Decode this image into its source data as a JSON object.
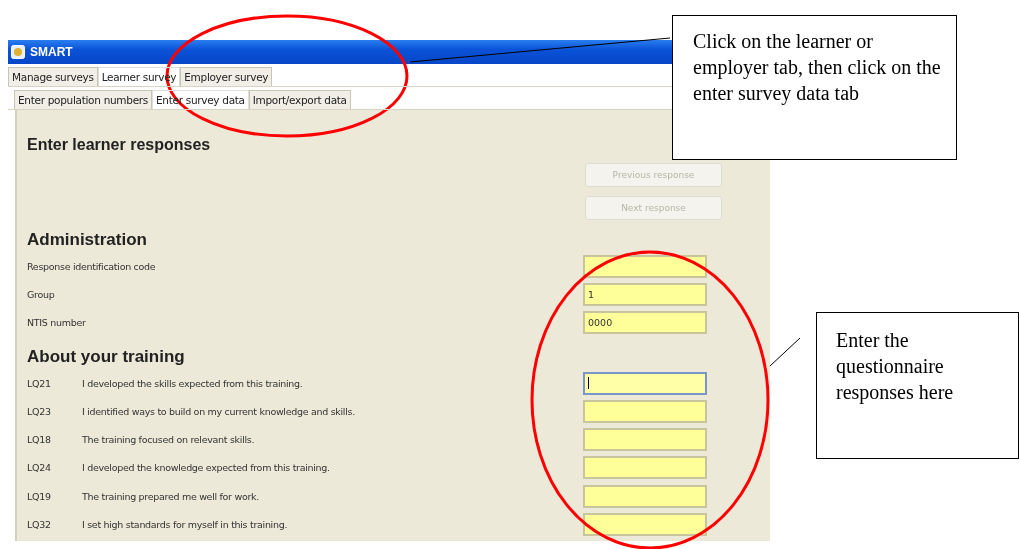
{
  "window": {
    "title": "SMART"
  },
  "tabs": [
    {
      "label": "Manage surveys",
      "selected": false
    },
    {
      "label": "Learner survey",
      "selected": true
    },
    {
      "label": "Employer survey",
      "selected": false
    }
  ],
  "subtabs": [
    {
      "label": "Enter population numbers",
      "selected": false
    },
    {
      "label": "Enter survey data",
      "selected": true
    },
    {
      "label": "Import/export data",
      "selected": false
    }
  ],
  "heading": "Enter learner responses",
  "buttons": [
    {
      "label": "Previous response",
      "disabled": true
    },
    {
      "label": "Next response",
      "disabled": true
    }
  ],
  "sections": [
    {
      "title": "Administration",
      "rows": [
        {
          "label": "Response identification code",
          "value": "",
          "focused": false
        },
        {
          "label": "Group",
          "value": "1",
          "focused": false
        },
        {
          "label": "NTIS number",
          "value": "0000",
          "focused": false
        }
      ]
    },
    {
      "title": "About your training",
      "rows": [
        {
          "code": "LQ21",
          "label": "I developed the skills expected from this training.",
          "value": "",
          "focused": true
        },
        {
          "code": "LQ23",
          "label": "I identified ways to build on my current knowledge and skills.",
          "value": "",
          "focused": false
        },
        {
          "code": "LQ18",
          "label": "The training focused on relevant skills.",
          "value": "",
          "focused": false
        },
        {
          "code": "LQ24",
          "label": "I developed the knowledge expected from this training.",
          "value": "",
          "focused": false
        },
        {
          "code": "LQ19",
          "label": "The training prepared me well for work.",
          "value": "",
          "focused": false
        },
        {
          "code": "LQ32",
          "label": "I set high standards for myself in this training.",
          "value": "",
          "focused": false
        }
      ]
    }
  ],
  "callouts": [
    "Click on the learner or employer tab, then click on the enter survey data tab",
    "Enter the questionnaire responses here"
  ]
}
